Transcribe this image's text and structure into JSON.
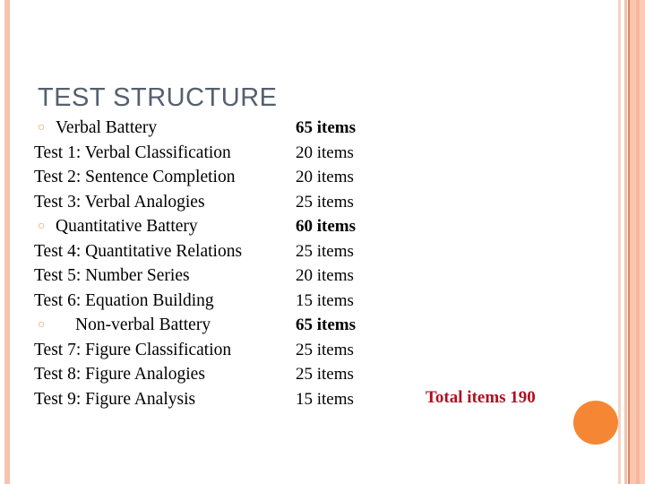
{
  "slide": {
    "title": "TEST STRUCTURE",
    "title_color": "#54606e",
    "background_color": "#ffffff",
    "accent_color": "#f58634",
    "total_color": "#b01020",
    "bullet_color": "#e8994f",
    "bullet_glyph": "○"
  },
  "rows": [
    {
      "label": "Verbal Battery",
      "count": "65 items",
      "type": "battery"
    },
    {
      "label": "Test 1: Verbal Classification",
      "count": "20 items",
      "type": "test"
    },
    {
      "label": "Test 2: Sentence Completion",
      "count": "20 items",
      "type": "test"
    },
    {
      "label": "Test 3:  Verbal Analogies",
      "count": "25 items",
      "type": "test"
    },
    {
      "label": "Quantitative Battery",
      "count": "60 items",
      "type": "battery"
    },
    {
      "label": "Test 4:  Quantitative Relations",
      "count": "25 items",
      "type": "test"
    },
    {
      "label": "Test 5:  Number Series",
      "count": "20 items",
      "type": "test"
    },
    {
      "label": "Test 6:  Equation Building",
      "count": "15 items",
      "type": "test"
    },
    {
      "label": "Non-verbal Battery",
      "count": "65 items",
      "type": "battery-indent"
    },
    {
      "label": "Test 7:  Figure Classification",
      "count": "25 items",
      "type": "test"
    },
    {
      "label": "Test 8:  Figure Analogies",
      "count": "25 items",
      "type": "test"
    },
    {
      "label": "Test 9:  Figure Analysis",
      "count": "15 items",
      "type": "test"
    }
  ],
  "total": {
    "text": "Total items 190"
  },
  "decorations": {
    "left_bar_color": "#f6c3ae",
    "right_bar_colors": [
      "#f4d3c4",
      "#f2c4b0",
      "#e8825a",
      "#fac6ae",
      "#f6b79c",
      "#fbcdb8"
    ]
  }
}
